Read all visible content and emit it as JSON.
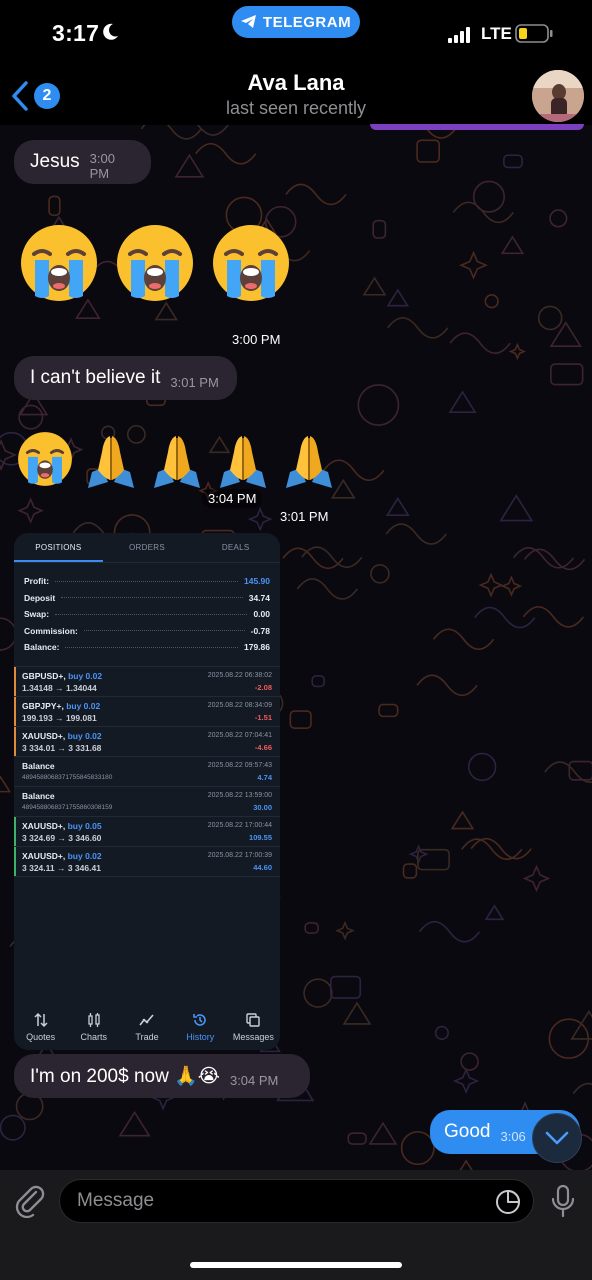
{
  "status_bar": {
    "time": "3:17",
    "pill_label": "TELEGRAM",
    "network": "LTE"
  },
  "header": {
    "unread_count": "2",
    "name": "Ava Lana",
    "status": "last seen recently"
  },
  "messages": {
    "m1": {
      "text": "Jesus",
      "time": "3:00 PM"
    },
    "emoji1_time": "3:00 PM",
    "m2": {
      "text": "I can't believe it",
      "time": "3:01 PM"
    },
    "emoji2_time": "3:01 PM",
    "image_time": "3:04 PM",
    "m3": {
      "text": "I'm on 200$ now 🙏😭",
      "time": "3:04 PM"
    },
    "out1": {
      "text": "Good",
      "time": "3:06"
    }
  },
  "trading": {
    "tabs": [
      "POSITIONS",
      "ORDERS",
      "DEALS"
    ],
    "summary": [
      {
        "label": "Profit:",
        "value": "145.90",
        "accent": true
      },
      {
        "label": "Deposit",
        "value": "34.74",
        "accent": false
      },
      {
        "label": "Swap:",
        "value": "0.00",
        "accent": false
      },
      {
        "label": "Commission:",
        "value": "-0.78",
        "accent": false
      },
      {
        "label": "Balance:",
        "value": "179.86",
        "accent": false
      }
    ],
    "deals": [
      {
        "symbol": "GBPUSD+,",
        "side": "buy 0.02",
        "prices": "1.34148 → 1.34044",
        "date": "2025.08.22 06:38:02",
        "amount": "-2.08",
        "edge": "#e08a3a"
      },
      {
        "symbol": "GBPJPY+,",
        "side": "buy 0.02",
        "prices": "199.193 → 199.081",
        "date": "2025.08.22 08:34:09",
        "amount": "-1.51",
        "edge": "#e08a3a"
      },
      {
        "symbol": "XAUUSD+,",
        "side": "buy 0.02",
        "prices": "3 334.01 → 3 331.68",
        "date": "2025.08.22 07:04:41",
        "amount": "-4.66",
        "edge": "#e08a3a"
      },
      {
        "symbol": "Balance",
        "side": "",
        "prices": "4894588068371755845833180",
        "date": "2025.08.22 09:57:43",
        "amount": "4.74",
        "edge": ""
      },
      {
        "symbol": "Balance",
        "side": "",
        "prices": "4894588068371755860308159",
        "date": "2025.08.22 13:59:00",
        "amount": "30.00",
        "edge": ""
      },
      {
        "symbol": "XAUUSD+,",
        "side": "buy 0.05",
        "prices": "3 324.69 → 3 346.60",
        "date": "2025.08.22 17:00:44",
        "amount": "109.55",
        "edge": "#3bb36b"
      },
      {
        "symbol": "XAUUSD+,",
        "side": "buy 0.02",
        "prices": "3 324.11 → 3 346.41",
        "date": "2025.08.22 17:00:39",
        "amount": "44.60",
        "edge": "#3bb36b"
      }
    ],
    "nav": [
      "Quotes",
      "Charts",
      "Trade",
      "History",
      "Messages"
    ]
  },
  "composer": {
    "placeholder": "Message"
  },
  "colors": {
    "accent": "#2f8df2",
    "incoming_bubble": "#2a2530",
    "profit_blue": "#4a94f5",
    "loss_red": "#f05a5a"
  }
}
